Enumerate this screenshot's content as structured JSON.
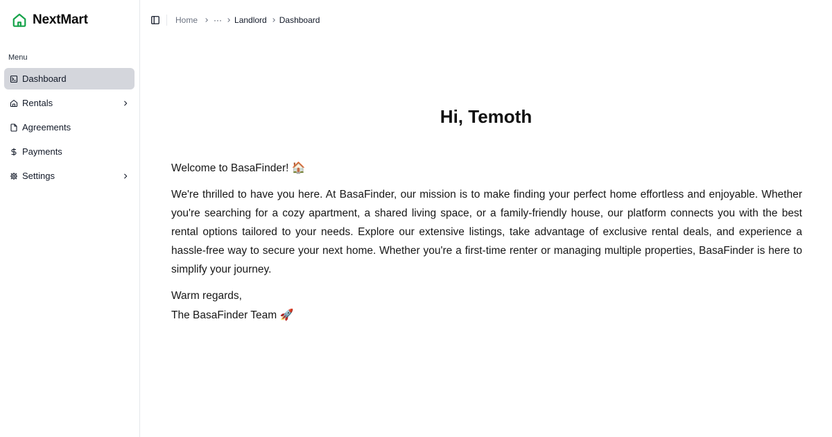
{
  "brand": {
    "name": "NextMart",
    "icon": "home-icon",
    "color": "#16a34a"
  },
  "sidebar": {
    "heading": "Menu",
    "items": [
      {
        "label": "Dashboard",
        "icon": "terminal-square-icon",
        "active": true,
        "has_submenu": false
      },
      {
        "label": "Rentals",
        "icon": "house-icon",
        "active": false,
        "has_submenu": true
      },
      {
        "label": "Agreements",
        "icon": "file-icon",
        "active": false,
        "has_submenu": false
      },
      {
        "label": "Payments",
        "icon": "dollar-sign-icon",
        "active": false,
        "has_submenu": false
      },
      {
        "label": "Settings",
        "icon": "gear-icon",
        "active": false,
        "has_submenu": true
      }
    ]
  },
  "breadcrumb": {
    "home": "Home",
    "ellipsis": "···",
    "parent": "Landlord",
    "current": "Dashboard"
  },
  "main": {
    "greeting": "Hi, Temoth",
    "welcome": "Welcome to BasaFinder!",
    "welcome_emoji": "🏠",
    "body": "We're thrilled to have you here. At BasaFinder, our mission is to make finding your perfect home effortless and enjoyable. Whether you're searching for a cozy apartment, a shared living space, or a family-friendly house, our platform connects you with the best rental options tailored to your needs. Explore our extensive listings, take advantage of exclusive rental deals, and experience a hassle-free way to secure your next home. Whether you're a first-time renter or managing multiple properties, BasaFinder is here to simplify your journey.",
    "signoff": "Warm regards,",
    "team": "The BasaFinder Team",
    "team_emoji": "🚀"
  }
}
